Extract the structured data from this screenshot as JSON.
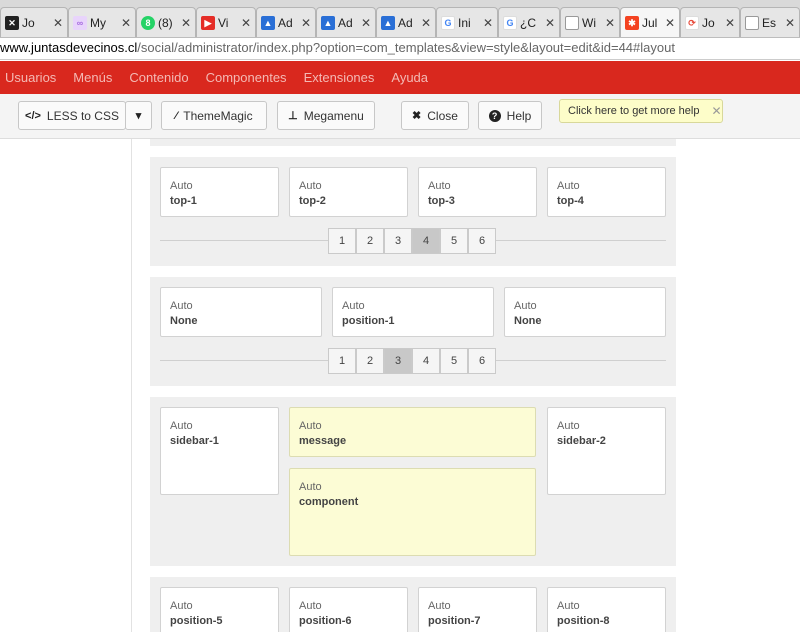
{
  "browser": {
    "tabs": [
      {
        "title": "Jo",
        "icon": "joomla-dark-icon",
        "color": "#222222"
      },
      {
        "title": "My",
        "icon": "colorful-rings-icon",
        "color": "#c9a0f0"
      },
      {
        "title": "(8)",
        "icon": "whatsapp-icon",
        "color": "#25d366"
      },
      {
        "title": "Vi",
        "icon": "youtube-icon",
        "color": "#e52d27"
      },
      {
        "title": "Ad",
        "icon": "google-ads-icon",
        "color": "#2a6fd6"
      },
      {
        "title": "Ad",
        "icon": "google-ads-icon",
        "color": "#2a6fd6"
      },
      {
        "title": "Ad",
        "icon": "google-ads-icon",
        "color": "#2a6fd6"
      },
      {
        "title": "Ini",
        "icon": "google-icon",
        "color": "#4285f4"
      },
      {
        "title": "¿C",
        "icon": "google-icon",
        "color": "#4285f4"
      },
      {
        "title": "Wi",
        "icon": "document-icon",
        "color": "#888888"
      },
      {
        "title": "Jul",
        "icon": "joomla-icon",
        "color": "#f44321"
      },
      {
        "title": "Jo",
        "icon": "sync-icon",
        "color": "#e74c3c"
      },
      {
        "title": "Es",
        "icon": "document-icon",
        "color": "#888888"
      }
    ],
    "url_host": "www.juntasdevecinos.cl",
    "url_path": "/social/administrator/index.php?option=com_templates&view=style&layout=edit&id=44#layout"
  },
  "admin_menu": [
    "Usuarios",
    "Menús",
    "Contenido",
    "Componentes",
    "Extensiones",
    "Ayuda"
  ],
  "toolbar": {
    "less": "LESS to CSS",
    "thememagic": "ThemeMagic",
    "megamenu": "Megamenu",
    "close": "Close",
    "help": "Help",
    "tip": "Click here to get more help"
  },
  "sections": {
    "top": {
      "blocks": [
        {
          "auto": "Auto",
          "name": "top-1"
        },
        {
          "auto": "Auto",
          "name": "top-2"
        },
        {
          "auto": "Auto",
          "name": "top-3"
        },
        {
          "auto": "Auto",
          "name": "top-4"
        }
      ],
      "pages": [
        "1",
        "2",
        "3",
        "4",
        "5",
        "6"
      ],
      "selected": "4"
    },
    "mid": {
      "blocks": [
        {
          "auto": "Auto",
          "name": "None"
        },
        {
          "auto": "Auto",
          "name": "position-1"
        },
        {
          "auto": "Auto",
          "name": "None"
        }
      ],
      "pages": [
        "1",
        "2",
        "3",
        "4",
        "5",
        "6"
      ],
      "selected": "3"
    },
    "main": {
      "sidebar1": {
        "auto": "Auto",
        "name": "sidebar-1"
      },
      "message": {
        "auto": "Auto",
        "name": "message"
      },
      "component": {
        "auto": "Auto",
        "name": "component"
      },
      "sidebar2": {
        "auto": "Auto",
        "name": "sidebar-2"
      }
    },
    "bottom": {
      "blocks": [
        {
          "auto": "Auto",
          "name": "position-5"
        },
        {
          "auto": "Auto",
          "name": "position-6"
        },
        {
          "auto": "Auto",
          "name": "position-7"
        },
        {
          "auto": "Auto",
          "name": "position-8"
        }
      ]
    }
  }
}
